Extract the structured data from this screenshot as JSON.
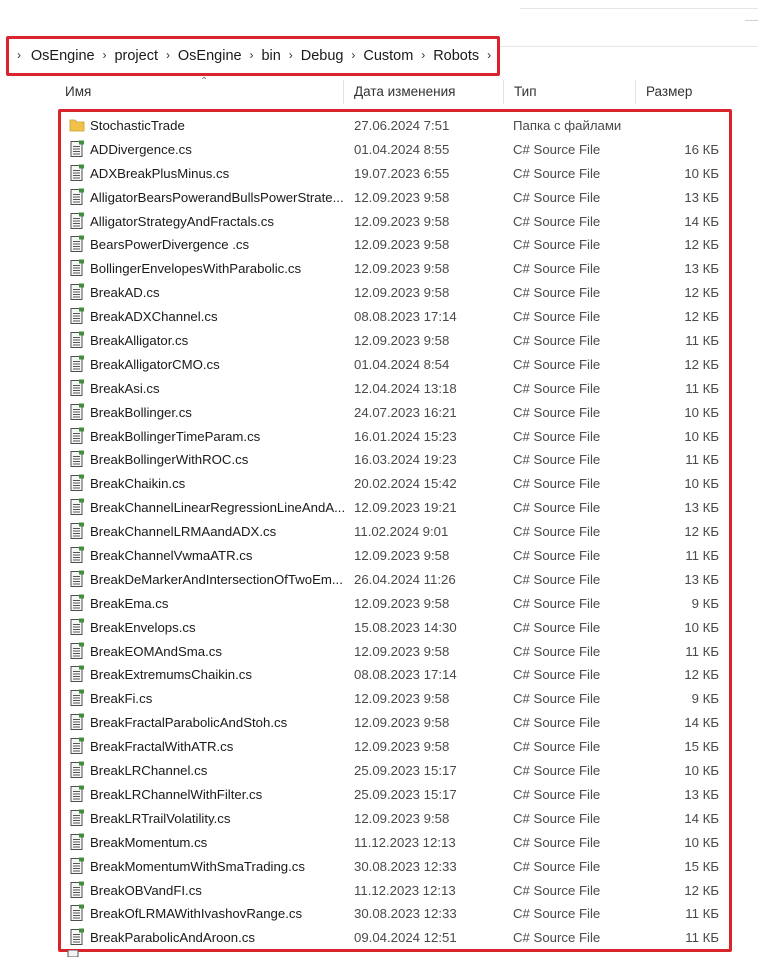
{
  "breadcrumb": {
    "items": [
      "OsEngine",
      "project",
      "OsEngine",
      "bin",
      "Debug",
      "Custom",
      "Robots"
    ],
    "separator": "›"
  },
  "columns": {
    "name": "Имя",
    "date": "Дата изменения",
    "type": "Тип",
    "size": "Размер"
  },
  "colors": {
    "highlight": "#d9242b",
    "folder": "#f0c24a"
  },
  "files": [
    {
      "name": "StochasticTrade",
      "date": "27.06.2024 7:51",
      "type": "Папка с файлами",
      "size": "",
      "icon": "folder-icon"
    },
    {
      "name": "ADDivergence.cs",
      "date": "01.04.2024 8:55",
      "type": "C# Source File",
      "size": "16 КБ",
      "icon": "cs-file-icon"
    },
    {
      "name": "ADXBreakPlusMinus.cs",
      "date": "19.07.2023 6:55",
      "type": "C# Source File",
      "size": "10 КБ",
      "icon": "cs-file-icon"
    },
    {
      "name": "AlligatorBearsPowerandBullsPowerStrate...",
      "date": "12.09.2023 9:58",
      "type": "C# Source File",
      "size": "13 КБ",
      "icon": "cs-file-icon"
    },
    {
      "name": "AlligatorStrategyAndFractals.cs",
      "date": "12.09.2023 9:58",
      "type": "C# Source File",
      "size": "14 КБ",
      "icon": "cs-file-icon"
    },
    {
      "name": "BearsPowerDivergence .cs",
      "date": "12.09.2023 9:58",
      "type": "C# Source File",
      "size": "12 КБ",
      "icon": "cs-file-icon"
    },
    {
      "name": "BollingerEnvelopesWithParabolic.cs",
      "date": "12.09.2023 9:58",
      "type": "C# Source File",
      "size": "13 КБ",
      "icon": "cs-file-icon"
    },
    {
      "name": "BreakAD.cs",
      "date": "12.09.2023 9:58",
      "type": "C# Source File",
      "size": "12 КБ",
      "icon": "cs-file-icon"
    },
    {
      "name": "BreakADXChannel.cs",
      "date": "08.08.2023 17:14",
      "type": "C# Source File",
      "size": "12 КБ",
      "icon": "cs-file-icon"
    },
    {
      "name": "BreakAlligator.cs",
      "date": "12.09.2023 9:58",
      "type": "C# Source File",
      "size": "11 КБ",
      "icon": "cs-file-icon"
    },
    {
      "name": "BreakAlligatorCMO.cs",
      "date": "01.04.2024 8:54",
      "type": "C# Source File",
      "size": "12 КБ",
      "icon": "cs-file-icon"
    },
    {
      "name": "BreakAsi.cs",
      "date": "12.04.2024 13:18",
      "type": "C# Source File",
      "size": "11 КБ",
      "icon": "cs-file-icon"
    },
    {
      "name": "BreakBollinger.cs",
      "date": "24.07.2023 16:21",
      "type": "C# Source File",
      "size": "10 КБ",
      "icon": "cs-file-icon"
    },
    {
      "name": "BreakBollingerTimeParam.cs",
      "date": "16.01.2024 15:23",
      "type": "C# Source File",
      "size": "10 КБ",
      "icon": "cs-file-icon"
    },
    {
      "name": "BreakBollingerWithROC.cs",
      "date": "16.03.2024 19:23",
      "type": "C# Source File",
      "size": "11 КБ",
      "icon": "cs-file-icon"
    },
    {
      "name": "BreakChaikin.cs",
      "date": "20.02.2024 15:42",
      "type": "C# Source File",
      "size": "10 КБ",
      "icon": "cs-file-icon"
    },
    {
      "name": "BreakChannelLinearRegressionLineAndA...",
      "date": "12.09.2023 19:21",
      "type": "C# Source File",
      "size": "13 КБ",
      "icon": "cs-file-icon"
    },
    {
      "name": "BreakChannelLRMAandADX.cs",
      "date": "11.02.2024 9:01",
      "type": "C# Source File",
      "size": "12 КБ",
      "icon": "cs-file-icon"
    },
    {
      "name": "BreakChannelVwmaATR.cs",
      "date": "12.09.2023 9:58",
      "type": "C# Source File",
      "size": "11 КБ",
      "icon": "cs-file-icon"
    },
    {
      "name": "BreakDeMarkerAndIntersectionOfTwoEm...",
      "date": "26.04.2024 11:26",
      "type": "C# Source File",
      "size": "13 КБ",
      "icon": "cs-file-icon"
    },
    {
      "name": "BreakEma.cs",
      "date": "12.09.2023 9:58",
      "type": "C# Source File",
      "size": "9 КБ",
      "icon": "cs-file-icon"
    },
    {
      "name": "BreakEnvelops.cs",
      "date": "15.08.2023 14:30",
      "type": "C# Source File",
      "size": "10 КБ",
      "icon": "cs-file-icon"
    },
    {
      "name": "BreakEOMAndSma.cs",
      "date": "12.09.2023 9:58",
      "type": "C# Source File",
      "size": "11 КБ",
      "icon": "cs-file-icon"
    },
    {
      "name": "BreakExtremumsChaikin.cs",
      "date": "08.08.2023 17:14",
      "type": "C# Source File",
      "size": "12 КБ",
      "icon": "cs-file-icon"
    },
    {
      "name": "BreakFi.cs",
      "date": "12.09.2023 9:58",
      "type": "C# Source File",
      "size": "9 КБ",
      "icon": "cs-file-icon"
    },
    {
      "name": "BreakFractalParabolicAndStoh.cs",
      "date": "12.09.2023 9:58",
      "type": "C# Source File",
      "size": "14 КБ",
      "icon": "cs-file-icon"
    },
    {
      "name": "BreakFractalWithATR.cs",
      "date": "12.09.2023 9:58",
      "type": "C# Source File",
      "size": "15 КБ",
      "icon": "cs-file-icon"
    },
    {
      "name": "BreakLRChannel.cs",
      "date": "25.09.2023 15:17",
      "type": "C# Source File",
      "size": "10 КБ",
      "icon": "cs-file-icon"
    },
    {
      "name": "BreakLRChannelWithFilter.cs",
      "date": "25.09.2023 15:17",
      "type": "C# Source File",
      "size": "13 КБ",
      "icon": "cs-file-icon"
    },
    {
      "name": "BreakLRTrailVolatility.cs",
      "date": "12.09.2023 9:58",
      "type": "C# Source File",
      "size": "14 КБ",
      "icon": "cs-file-icon"
    },
    {
      "name": "BreakMomentum.cs",
      "date": "11.12.2023 12:13",
      "type": "C# Source File",
      "size": "10 КБ",
      "icon": "cs-file-icon"
    },
    {
      "name": "BreakMomentumWithSmaTrading.cs",
      "date": "30.08.2023 12:33",
      "type": "C# Source File",
      "size": "15 КБ",
      "icon": "cs-file-icon"
    },
    {
      "name": "BreakOBVandFI.cs",
      "date": "11.12.2023 12:13",
      "type": "C# Source File",
      "size": "12 КБ",
      "icon": "cs-file-icon"
    },
    {
      "name": "BreakOfLRMAWithIvashovRange.cs",
      "date": "30.08.2023 12:33",
      "type": "C# Source File",
      "size": "11 КБ",
      "icon": "cs-file-icon"
    },
    {
      "name": "BreakParabolicAndAroon.cs",
      "date": "09.04.2024 12:51",
      "type": "C# Source File",
      "size": "11 КБ",
      "icon": "cs-file-icon"
    }
  ]
}
